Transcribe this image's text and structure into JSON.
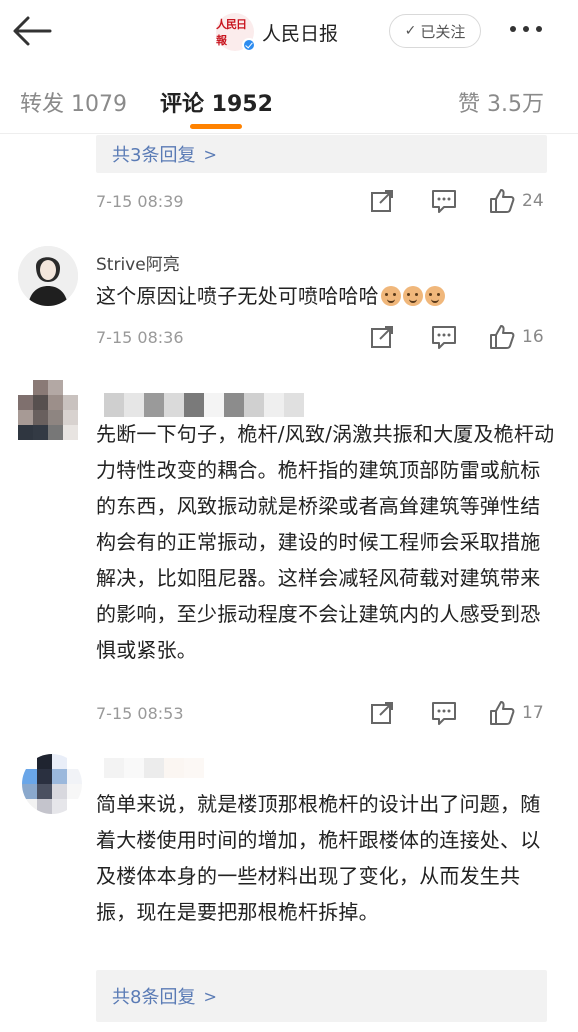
{
  "header": {
    "account_name": "人民日报",
    "logo_text": "人民日報",
    "follow_label": "已关注"
  },
  "tabs": {
    "repost": "转发 1079",
    "comments": "评论 1952",
    "likes": "赞 3.5万"
  },
  "comments": [
    {
      "reply_link": "共3条回复",
      "time": "7-15 08:39",
      "likes": "24"
    },
    {
      "nickname": "Strive阿亮",
      "text": "这个原因让喷子无处可喷哈哈哈",
      "time": "7-15 08:36",
      "likes": "16"
    },
    {
      "text": "先断一下句子，桅杆/风致/涡激共振和大厦及桅杆动力特性改变的耦合。桅杆指的建筑顶部防雷或航标的东西，风致振动就是桥梁或者高耸建筑等弹性结构会有的正常振动，建设的时候工程师会采取措施解决，比如阻尼器。这样会减轻风荷载对建筑带来的影响，至少振动程度不会让建筑内的人感受到恐惧或紧张。",
      "time": "7-15 08:53",
      "likes": "17"
    },
    {
      "text": "简单来说，就是楼顶那根桅杆的设计出了问题，随着大楼使用时间的增加，桅杆跟楼体的连接处、以及楼体本身的一些材料出现了变化，从而发生共振，现在是要把那根桅杆拆掉。",
      "reply_link": "共8条回复"
    }
  ],
  "colors": {
    "accent_orange": "#ff8200",
    "link_blue": "#5a7bb5",
    "verified_blue": "#2d8cf0"
  },
  "icons": [
    "back-arrow-icon",
    "verified-icon",
    "check-icon",
    "more-icon",
    "share-icon",
    "comment-icon",
    "like-icon",
    "chevron-right-icon",
    "cat-emoji-icon"
  ]
}
